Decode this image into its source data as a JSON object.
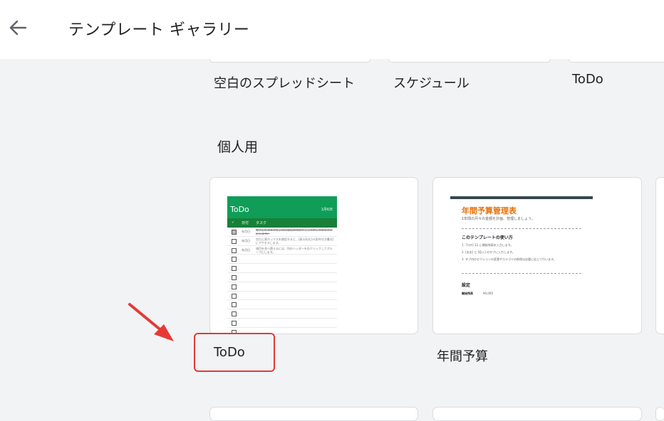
{
  "header": {
    "title": "テンプレート ギャラリー",
    "back_icon": "arrow-back-icon"
  },
  "top_row": [
    {
      "label": "空白のスプレッドシート"
    },
    {
      "label": "スケジュール"
    },
    {
      "label": "ToDo"
    }
  ],
  "section": {
    "title": "個人用"
  },
  "cards": [
    {
      "label": "ToDo",
      "thumb": {
        "title": "ToDo",
        "date": "1月6日",
        "col_check": "✓",
        "col_date": "日付",
        "col_task": "タスク",
        "rows": [
          {
            "date": "年月日",
            "text": "完了したタスクを示すには左の列のチェックボックスをオンにします。"
          },
          {
            "date": "年月日",
            "text": "空白と黒ボックスを使用すると、[表示形式]>[条件付き書式]にアクセスします。"
          },
          {
            "date": "年月日",
            "text": "項目を並べ替えるには、列のヘッダーを右クリックしてグループにします。"
          }
        ]
      }
    },
    {
      "label": "年間予算",
      "thumb": {
        "title": "年間予算管理表",
        "subtitle": "1年間の月々の金額を計画、管理しましょう。",
        "how_title": "このテンプレートの使い方",
        "steps": [
          "1. 下の行 12 に開始残高を入力します。",
          "2. [支出] と [収入] のタブに入力します。",
          "3. タブ内のセクションの変更やカテゴリの削除は必要に応じて行います。"
        ],
        "settings_title": "設定",
        "start_label": "開始残高",
        "start_value": "¥0,000"
      }
    }
  ],
  "colors": {
    "todo_green": "#0f9d58",
    "highlight_red": "#e53935",
    "budget_orange": "#e8710a"
  }
}
